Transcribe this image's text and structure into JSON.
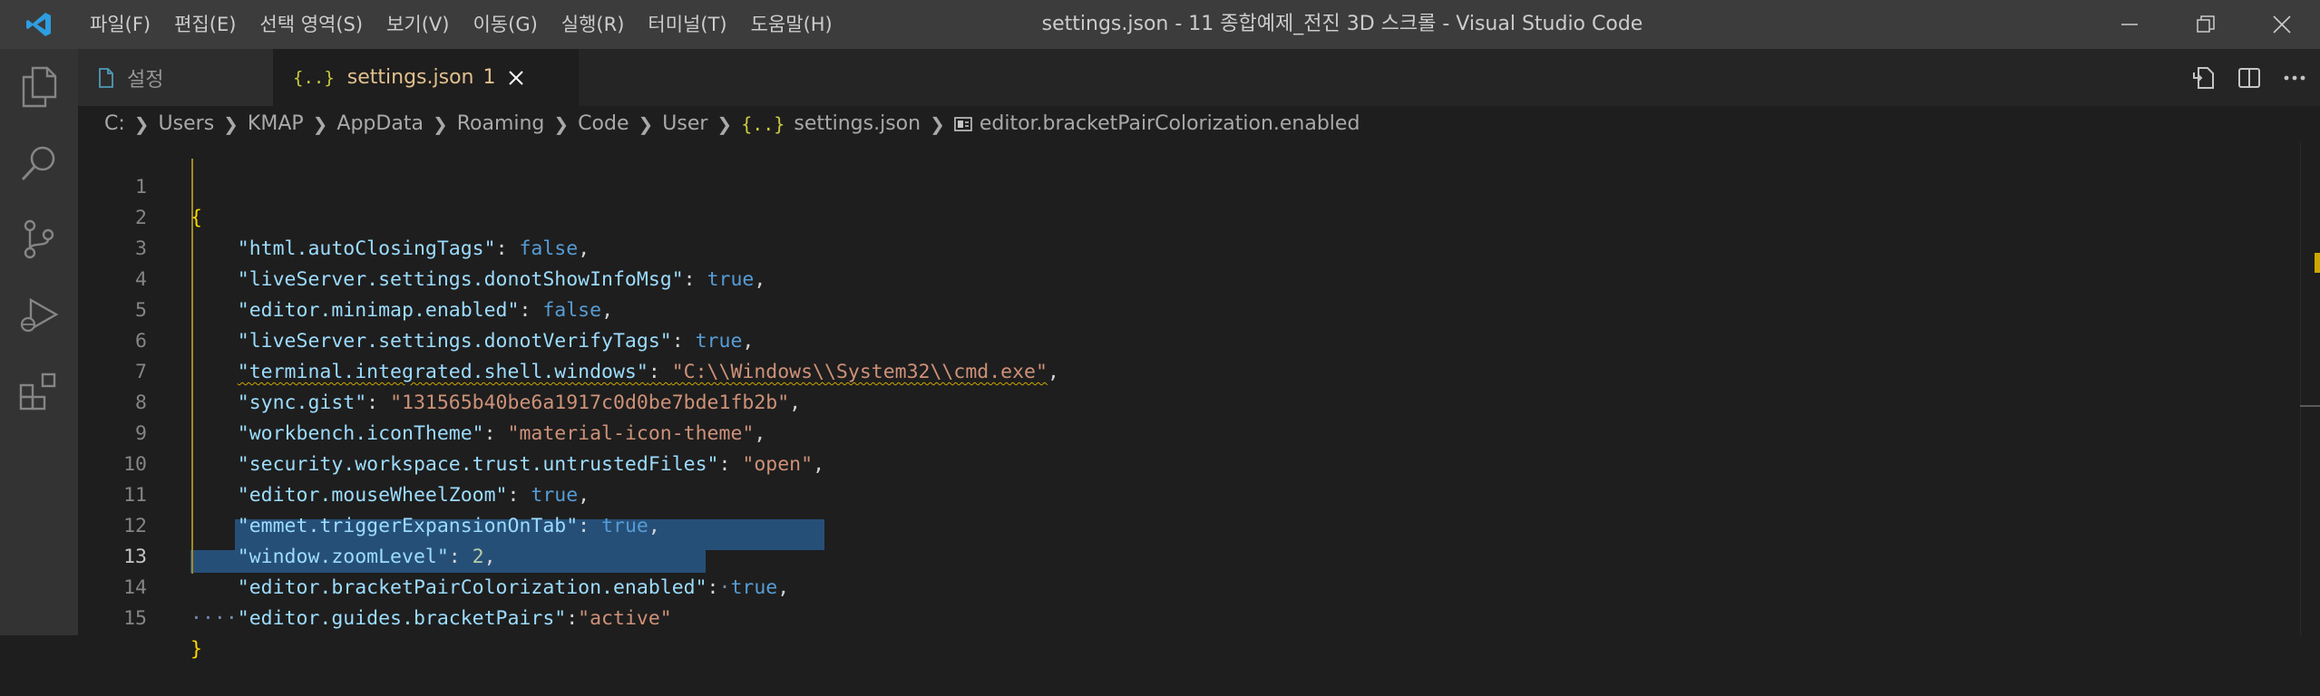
{
  "window": {
    "title": "settings.json - 11 종합예제_전진 3D 스크롤 - Visual Studio Code"
  },
  "menu": [
    {
      "label": "파일(F)"
    },
    {
      "label": "편집(E)"
    },
    {
      "label": "선택 영역(S)"
    },
    {
      "label": "보기(V)"
    },
    {
      "label": "이동(G)"
    },
    {
      "label": "실행(R)"
    },
    {
      "label": "터미널(T)"
    },
    {
      "label": "도움말(H)"
    }
  ],
  "tabs": [
    {
      "label": "설정",
      "icon": "file-icon"
    },
    {
      "label": "settings.json",
      "badge": "1",
      "icon": "json-braces-icon",
      "active": true
    }
  ],
  "breadcrumb": {
    "items": [
      "C:",
      "Users",
      "KMAP",
      "AppData",
      "Roaming",
      "Code",
      "User",
      "settings.json",
      "editor.bracketPairColorization.enabled"
    ],
    "file_icon": "{..}"
  },
  "editor": {
    "active_line": 13,
    "lines": [
      {
        "n": "1"
      },
      {
        "n": "2"
      },
      {
        "n": "3"
      },
      {
        "n": "4"
      },
      {
        "n": "5"
      },
      {
        "n": "6"
      },
      {
        "n": "7"
      },
      {
        "n": "8"
      },
      {
        "n": "9"
      },
      {
        "n": "10"
      },
      {
        "n": "11"
      },
      {
        "n": "12"
      },
      {
        "n": "13"
      },
      {
        "n": "14"
      },
      {
        "n": "15"
      }
    ],
    "tokens": {
      "open": "{",
      "close": "}",
      "l2k": "\"html.autoClosingTags\"",
      "l2v": "false",
      "l3k": "\"liveServer.settings.donotShowInfoMsg\"",
      "l3v": "true",
      "l4k": "\"editor.minimap.enabled\"",
      "l4v": "false",
      "l5k": "\"liveServer.settings.donotVerifyTags\"",
      "l5v": "true",
      "l6k": "\"terminal.integrated.shell.windows\"",
      "l6v": "\"C:\\\\Windows\\\\System32\\\\cmd.exe\"",
      "l7k": "\"sync.gist\"",
      "l7v": "\"131565b40be6a1917c0d0be7bde1fb2b\"",
      "l8k": "\"workbench.iconTheme\"",
      "l8v": "\"material-icon-theme\"",
      "l9k": "\"security.workspace.trust.untrustedFiles\"",
      "l9v": "\"open\"",
      "l10k": "\"editor.mouseWheelZoom\"",
      "l10v": "true",
      "l11k": "\"emmet.triggerExpansionOnTab\"",
      "l11v": "true",
      "l12k": "\"window.zoomLevel\"",
      "l12v": "2",
      "l13k": "\"editor.bracketPairColorization.enabled\"",
      "l13v": "true",
      "l14k": "\"editor.guides.bracketPairs\"",
      "l14v": "\"active\""
    }
  },
  "colors": {
    "titlebar": "#3c3c3c",
    "activitybar": "#333333",
    "editor_bg": "#1e1e1e",
    "selection": "#264f78",
    "key": "#9cdcfe",
    "string": "#ce9178",
    "boolean": "#569cd6",
    "number": "#b5cea8",
    "tab_modified": "#e2c08d"
  }
}
